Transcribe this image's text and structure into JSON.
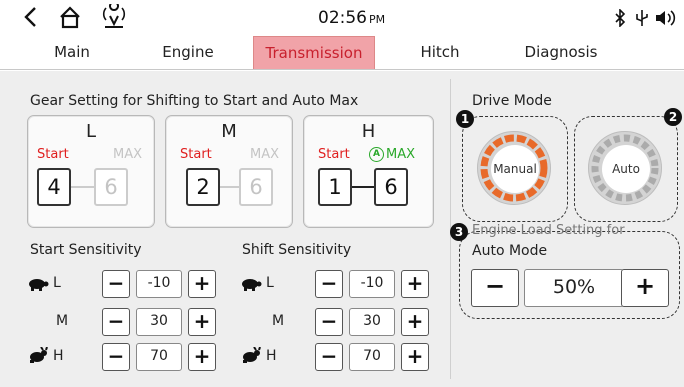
{
  "status_bar": {
    "back_icon": "chevron-left-icon",
    "home_icon": "home-icon",
    "location_icon": "location-signal-icon",
    "time": "02:56",
    "ampm": "PM",
    "bluetooth_icon": "bluetooth-icon",
    "usb_icon": "usb-icon",
    "volume_icon": "volume-icon"
  },
  "tabs": [
    "Main",
    "Engine",
    "Transmission",
    "Hitch",
    "Diagnosis"
  ],
  "active_tab": "Transmission",
  "gear_setting": {
    "title": "Gear Setting for Shifting to Start and Auto Max",
    "start_label": "Start",
    "max_label": "MAX",
    "auto_icon": "A",
    "gears": [
      {
        "letter": "L",
        "start": "4",
        "max": "6",
        "max_active": false
      },
      {
        "letter": "M",
        "start": "2",
        "max": "6",
        "max_active": false
      },
      {
        "letter": "H",
        "start": "1",
        "max": "6",
        "max_active": true
      }
    ]
  },
  "start_sensitivity": {
    "title": "Start Sensitivity",
    "rows": [
      {
        "icon": "turtle-icon",
        "label": "L",
        "value": "-10"
      },
      {
        "icon": "",
        "label": "M",
        "value": "30"
      },
      {
        "icon": "rabbit-icon",
        "label": "H",
        "value": "70"
      }
    ]
  },
  "shift_sensitivity": {
    "title": "Shift Sensitivity",
    "rows": [
      {
        "icon": "turtle-icon",
        "label": "L",
        "value": "-10"
      },
      {
        "icon": "",
        "label": "M",
        "value": "30"
      },
      {
        "icon": "rabbit-icon",
        "label": "H",
        "value": "70"
      }
    ]
  },
  "drive_mode": {
    "title": "Drive Mode",
    "manual_label": "Manual",
    "auto_label": "Auto",
    "callouts": [
      "1",
      "2",
      "3"
    ]
  },
  "load_setting": {
    "title_line1": "Engine  Load Setting for",
    "title_line2": "Auto Mode",
    "value": "50%",
    "minus": "−",
    "plus": "+"
  },
  "buttons": {
    "minus": "−",
    "plus": "+"
  },
  "colors": {
    "accent_red": "#e02020",
    "active_tab_bg": "#f1a3a8",
    "max_green": "#2aa82a"
  }
}
